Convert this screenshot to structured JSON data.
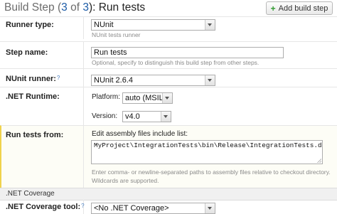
{
  "header": {
    "title_prefix": "Build Step (",
    "step_current": "3",
    "step_of": " of ",
    "step_total": "3",
    "title_suffix": "): Run tests",
    "add_button": "Add build step",
    "add_icon": "+"
  },
  "runner_type": {
    "label": "Runner type:",
    "value": "NUnit",
    "note": "NUnit tests runner"
  },
  "step_name": {
    "label": "Step name:",
    "value": "Run tests",
    "note": "Optional, specify to distinguish this build step from other steps."
  },
  "nunit_runner": {
    "label": "NUnit runner:",
    "help": "?",
    "value": "NUnit 2.6.4"
  },
  "net_runtime": {
    "label": ".NET Runtime:",
    "platform_label": "Platform:",
    "platform_value": "auto (MSIL)",
    "version_label": "Version:",
    "version_value": "v4.0"
  },
  "run_tests_from": {
    "label": "Run tests from:",
    "edit_label": "Edit assembly files include list:",
    "value": "MyProject\\IntegrationTests\\bin\\Release\\IntegrationTests.dll",
    "note_line1": "Enter comma- or newline-separated paths to assembly files relative to checkout directory.",
    "note_line2": "Wildcards are supported."
  },
  "coverage_section": {
    "title": ".NET Coverage"
  },
  "coverage_tool": {
    "label": ".NET Coverage tool:",
    "help": "?",
    "value": "<No .NET Coverage>"
  },
  "colors": {
    "link_blue": "#1a5aa6",
    "highlight_border": "#f0d24c",
    "add_icon": "#2f9a2f"
  }
}
